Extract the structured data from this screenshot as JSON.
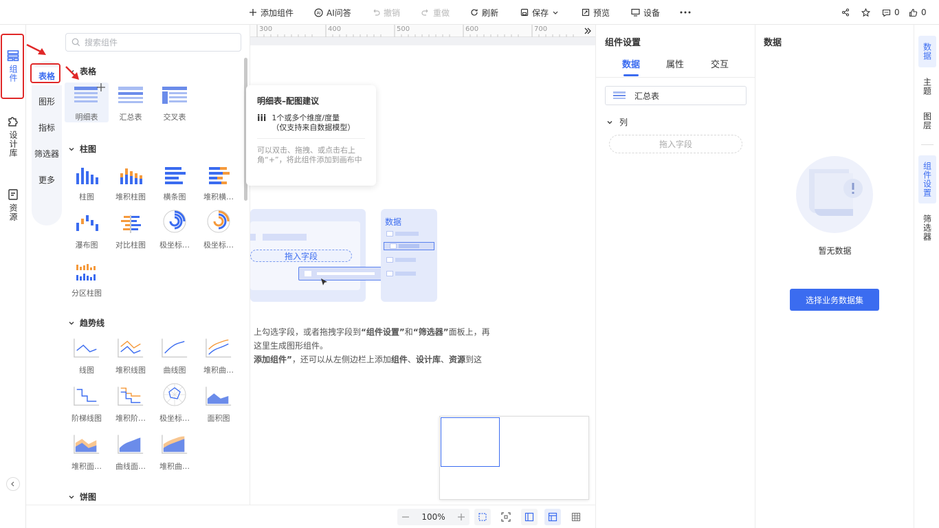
{
  "toolbar": {
    "add_component": "添加组件",
    "ai_qa": "AI问答",
    "undo": "撤销",
    "redo": "重做",
    "refresh": "刷新",
    "save": "保存",
    "preview": "预览",
    "device": "设备",
    "comments_count": "0",
    "likes_count": "0"
  },
  "leftbar": {
    "components": "组件",
    "design_library": "设计库",
    "resources": "资源"
  },
  "panel": {
    "search_placeholder": "搜索组件",
    "categories": [
      "表格",
      "图形",
      "指标",
      "筛选器",
      "更多"
    ],
    "sections": {
      "table": {
        "title": "表格",
        "items": [
          "明细表",
          "汇总表",
          "交叉表"
        ]
      },
      "bar": {
        "title": "柱图",
        "items": [
          "柱图",
          "堆积柱图",
          "横条图",
          "堆积横…",
          "瀑布图",
          "对比柱图",
          "极坐标…",
          "极坐标…",
          "分区柱图"
        ]
      },
      "trend": {
        "title": "趋势线",
        "items": [
          "线图",
          "堆积线图",
          "曲线图",
          "堆积曲…",
          "阶梯线图",
          "堆积阶…",
          "极坐标…",
          "面积图",
          "堆积面…",
          "曲线面…",
          "堆积曲…"
        ]
      },
      "pie": {
        "title": "饼图"
      }
    }
  },
  "tooltip": {
    "title": "明细表–配图建议",
    "req_line1": "1个或多个维度/度量",
    "req_line2": "（仅支持来自数据模型）",
    "hint": "可以双击、拖拽、或点击右上角“+”，将此组件添加到画布中"
  },
  "canvas": {
    "ruler_ticks": [
      "300",
      "400",
      "500",
      "600",
      "700"
    ],
    "illus_drop": "拖入字段",
    "illus_data": "数据",
    "help_line1_pre": "上勾选字段，或者拖拽字段到",
    "help_line1_b1": "“组件设置”",
    "help_line1_mid": "和",
    "help_line1_b2": "“筛选器”",
    "help_line1_post": "面板上，再",
    "help_line2": "这里生成图形组件。",
    "help_line3_b": "添加组件”",
    "help_line3_mid": "，还可以从左侧边栏上添加",
    "help_line3_b2": "组件",
    "help_line3_sep1": "、",
    "help_line3_b3": "设计库",
    "help_line3_sep2": "、",
    "help_line3_b4": "资源",
    "help_line3_post": "到这"
  },
  "zoom": {
    "level": "100%"
  },
  "settings": {
    "title": "组件设置",
    "tabs": [
      "数据",
      "属性",
      "交互"
    ],
    "selected_component": "汇总表",
    "column_section": "列",
    "drop_field": "拖入字段"
  },
  "datapanel": {
    "title": "数据",
    "empty_text": "暂无数据",
    "select_button": "选择业务数据集"
  },
  "rightrail": {
    "items": [
      "数据",
      "主题",
      "图层",
      "组件设置",
      "筛选器"
    ]
  },
  "colors": {
    "accent": "#3b6cf0",
    "orange": "#f59a3c",
    "annotation_red": "#e02828"
  }
}
